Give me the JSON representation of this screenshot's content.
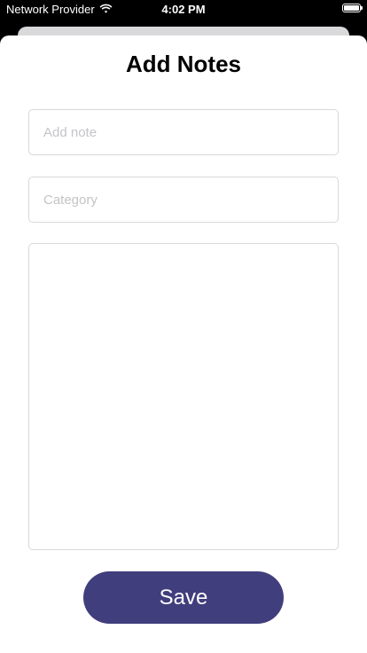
{
  "status_bar": {
    "carrier": "Network Provider",
    "time": "4:02 PM",
    "battery_level": 1.0
  },
  "colors": {
    "accent": "#413e7d",
    "field_border": "#d8d8dc",
    "placeholder": "#c4c4c8"
  },
  "form": {
    "title": "Add Notes",
    "note_input": {
      "placeholder": "Add note",
      "value": ""
    },
    "category_input": {
      "placeholder": "Category",
      "value": ""
    },
    "body_textarea": {
      "placeholder": "",
      "value": ""
    },
    "save_label": "Save"
  },
  "icons": {
    "wifi": "wifi-icon",
    "battery": "battery-icon"
  }
}
